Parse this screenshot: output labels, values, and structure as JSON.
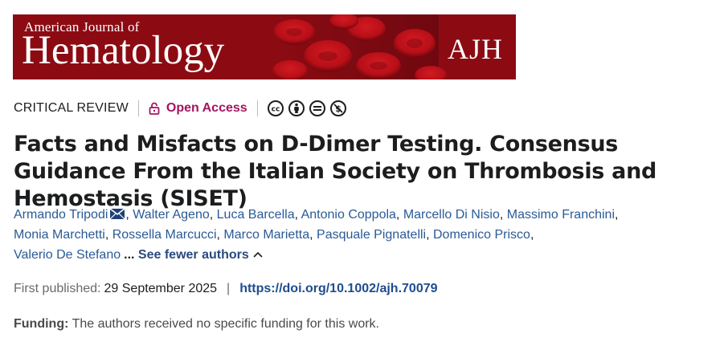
{
  "banner": {
    "journal_top": "American Journal of",
    "journal_main": "Hematology",
    "journal_abbr": "AJH"
  },
  "meta": {
    "article_type": "CRITICAL REVIEW",
    "open_access": "Open Access",
    "license_icons": [
      "cc-icon",
      "by-icon",
      "nd-icon",
      "nc-icon"
    ],
    "open_access_color": "#a3145f"
  },
  "title": "Facts and Misfacts on D-Dimer Testing. Consensus Guidance From the Italian Society on Thrombosis and Hemostasis (SISET)",
  "authors": {
    "list": [
      "Armando Tripodi",
      "Walter Ageno",
      "Luca Barcella",
      "Antonio Coppola",
      "Marcello Di Nisio",
      "Massimo Franchini",
      "Monia Marchetti",
      "Rossella Marcucci",
      "Marco Marietta",
      "Pasquale Pignatelli",
      "Domenico Prisco",
      "Valerio De Stefano"
    ],
    "ellipsis": "...",
    "see_fewer": "See fewer authors"
  },
  "publication": {
    "label": "First published:",
    "date": "29 September 2025",
    "separator": "|",
    "doi": "https://doi.org/10.1002/ajh.70079"
  },
  "funding": {
    "label": "Funding:",
    "text": "The authors received no specific funding for this work."
  }
}
